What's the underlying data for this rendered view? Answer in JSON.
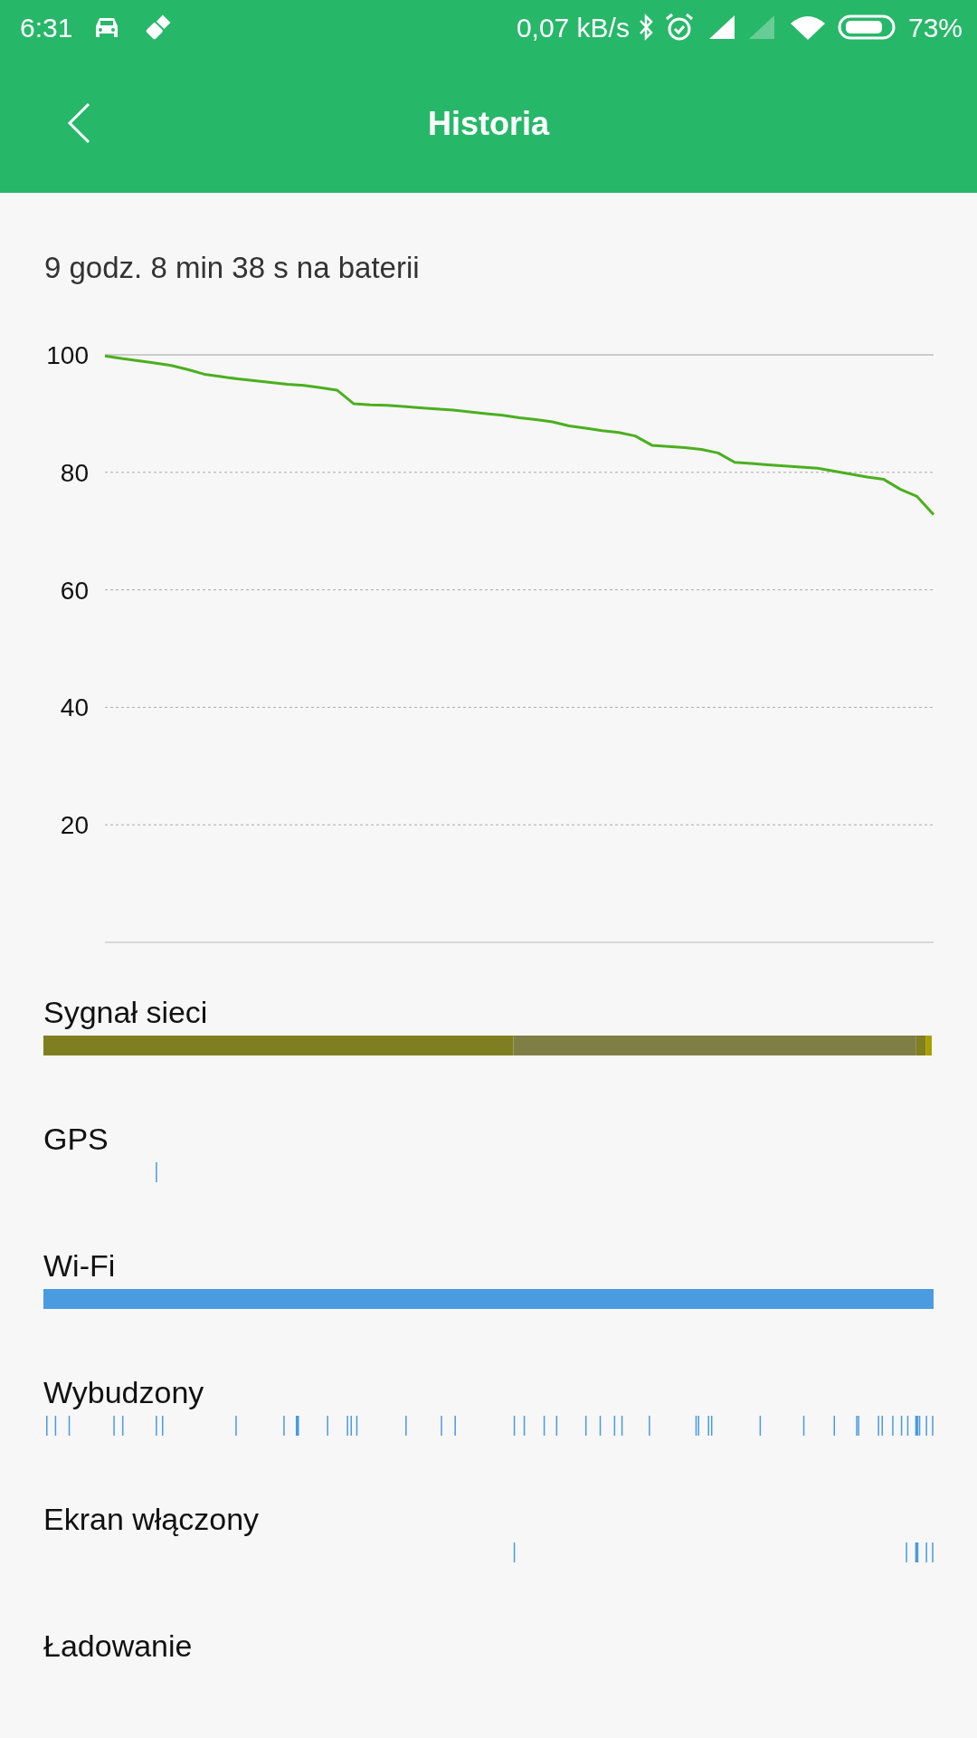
{
  "status_bar": {
    "time": "6:31",
    "net_speed": "0,07 kB/s",
    "battery": "73%"
  },
  "header": {
    "title": "Historia"
  },
  "summary": "9 godz. 8 min 38 s na baterii",
  "battery_chart": {
    "chart_data": {
      "type": "line",
      "ylim": [
        0,
        100
      ],
      "yticks": [
        20,
        40,
        60,
        80,
        100
      ],
      "categories": [
        null,
        null,
        null,
        null,
        null,
        null,
        null,
        null,
        null,
        null,
        null,
        null,
        null,
        null,
        null,
        null,
        null,
        null,
        null,
        null,
        null,
        null,
        null,
        null,
        null,
        null,
        null,
        null,
        null,
        null,
        null,
        null,
        null,
        null,
        null,
        null,
        null,
        null,
        null,
        null,
        null,
        null,
        null,
        null,
        null,
        null,
        null,
        null,
        null,
        null,
        null
      ],
      "grid": true,
      "values": [
        99.8,
        99.4,
        99,
        98.6,
        98.2,
        97.5,
        96.7,
        96.3,
        95.9,
        95.6,
        95.3,
        95,
        94.8,
        94.4,
        94,
        91.7,
        91.5,
        91.4,
        91.2,
        91,
        90.8,
        90.6,
        90.3,
        90,
        89.7,
        89.3,
        89,
        88.6,
        87.9,
        87.5,
        87.1,
        86.8,
        86.2,
        84.6,
        84.4,
        84.2,
        83.9,
        83.3,
        81.7,
        81.5,
        81.3,
        81.1,
        80.9,
        80.7,
        80.2,
        79.7,
        79.2,
        78.8,
        77.1,
        75.9,
        72.8
      ]
    }
  },
  "tracks": [
    {
      "label": "Sygnał sieci",
      "kind": "band"
    },
    {
      "label": "GPS",
      "kind": "ticks"
    },
    {
      "label": "Wi-Fi",
      "kind": "full"
    },
    {
      "label": "Wybudzony",
      "kind": "ticks"
    },
    {
      "label": "Ekran włączony",
      "kind": "ticks"
    },
    {
      "label": "Ładowanie"
    }
  ]
}
